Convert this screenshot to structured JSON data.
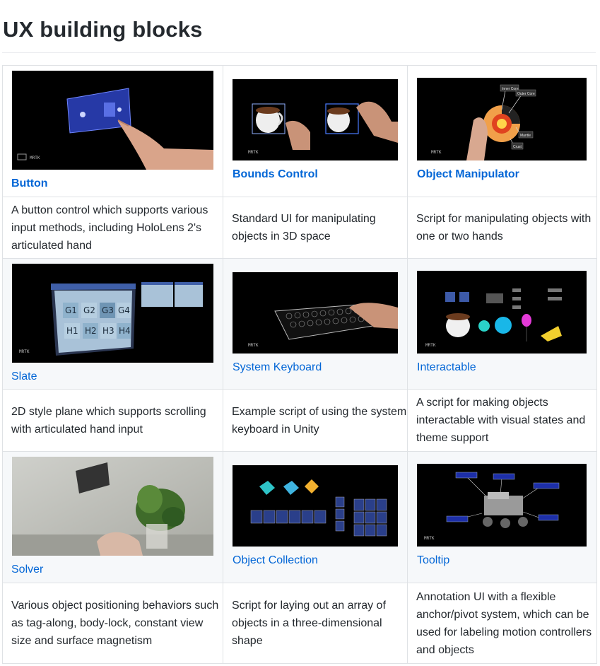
{
  "heading": "UX building blocks",
  "rows": [
    {
      "items": [
        {
          "name": "Button",
          "description": "A button control which supports various input methods, including HoloLens 2's articulated hand"
        },
        {
          "name": "Bounds Control",
          "description": "Standard UI for manipulating objects in 3D space"
        },
        {
          "name": "Object Manipulator",
          "description": "Script for manipulating objects with one or two hands"
        }
      ]
    },
    {
      "items": [
        {
          "name": "Slate",
          "description": "2D style plane which supports scrolling with articulated hand input"
        },
        {
          "name": "System Keyboard",
          "description": "Example script of using the system keyboard in Unity"
        },
        {
          "name": "Interactable",
          "description": "A script for making objects interactable with visual states and theme support"
        }
      ]
    },
    {
      "items": [
        {
          "name": "Solver",
          "description": "Various object positioning behaviors such as tag-along, body-lock, constant view size and surface magnetism"
        },
        {
          "name": "Object Collection",
          "description": "Script for laying out an array of objects in a three-dimensional shape"
        },
        {
          "name": "Tooltip",
          "description": "Annotation UI with a flexible anchor/pivot system, which can be used for labeling motion controllers and objects"
        }
      ]
    }
  ],
  "image_text": {
    "watermark": "MRTK",
    "slate_tiles": [
      "G1",
      "G2",
      "G3",
      "G4",
      "H1",
      "H2",
      "H3",
      "H4"
    ],
    "planet_labels": [
      "Inner Core",
      "Outer Core",
      "Mantle",
      "Crust"
    ]
  },
  "colors": {
    "link": "#0366d6",
    "border": "#dfe2e5",
    "alt_row": "#f6f8fa"
  }
}
